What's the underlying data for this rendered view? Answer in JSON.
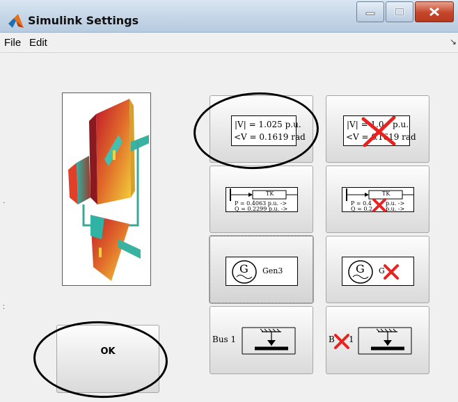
{
  "window": {
    "title": "Simulink Settings",
    "controls": {
      "minimize_icon": "minimize-icon",
      "maximize_icon": "maximize-icon",
      "close_icon": "close-icon"
    }
  },
  "menu": {
    "items": [
      {
        "label": "File"
      },
      {
        "label": "Edit"
      }
    ]
  },
  "ok_button": {
    "label": "OK"
  },
  "buttons": {
    "voltage_on": {
      "line1": "|V| = 1.025 p.u.",
      "line2": "<V = 0.1619 rad"
    },
    "voltage_off": {
      "line1": "|V| = 1.0",
      "line1b": "p.u.",
      "line2": "<V = 0",
      "line2b": ".1619 rad"
    },
    "flow_on": {
      "box_label": "TK",
      "p_label": "P = 0.4063 p.u. ->",
      "q_label": "Q = 0.2299 p.u. ->"
    },
    "flow_off": {
      "box_label": "TK",
      "p_label": "P = 0.4",
      "p_label_b": "p.u. ->",
      "q_label": "Q = 0.2",
      "q_label_b": "p.u. ->"
    },
    "generator_on": {
      "symbol": "G",
      "label": "Gen3"
    },
    "generator_off": {
      "symbol": "G",
      "label": "G"
    },
    "bus_on": {
      "label": "Bus 1"
    },
    "bus_off": {
      "label": "B",
      "label_b": "1"
    }
  },
  "colors": {
    "red_x": "#e8231f",
    "annotation": "#000000"
  }
}
